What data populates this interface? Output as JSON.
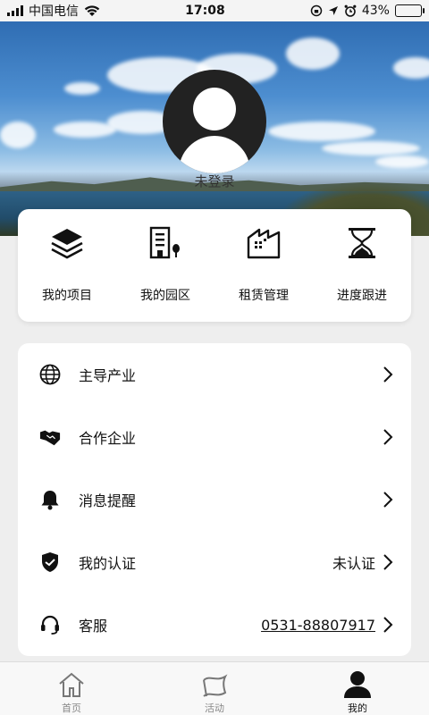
{
  "status_bar": {
    "carrier": "中国电信",
    "time": "17:08",
    "battery": "43%",
    "battery_level": 0.43
  },
  "profile": {
    "login_text": "未登录"
  },
  "quick_actions": [
    {
      "label": "我的项目",
      "icon": "layers-icon"
    },
    {
      "label": "我的园区",
      "icon": "building-icon"
    },
    {
      "label": "租赁管理",
      "icon": "factory-icon"
    },
    {
      "label": "进度跟进",
      "icon": "hourglass-icon"
    }
  ],
  "menu": [
    {
      "label": "主导产业",
      "icon": "globe-icon",
      "value": ""
    },
    {
      "label": "合作企业",
      "icon": "handshake-icon",
      "value": ""
    },
    {
      "label": "消息提醒",
      "icon": "bell-icon",
      "value": ""
    },
    {
      "label": "我的认证",
      "icon": "shield-check-icon",
      "value": "未认证"
    },
    {
      "label": "客服",
      "icon": "headset-icon",
      "value": "0531-88807917"
    }
  ],
  "tabs": [
    {
      "label": "首页",
      "icon": "home-icon",
      "active": false
    },
    {
      "label": "活动",
      "icon": "flag-icon",
      "active": false
    },
    {
      "label": "我的",
      "icon": "user-icon",
      "active": true
    }
  ]
}
